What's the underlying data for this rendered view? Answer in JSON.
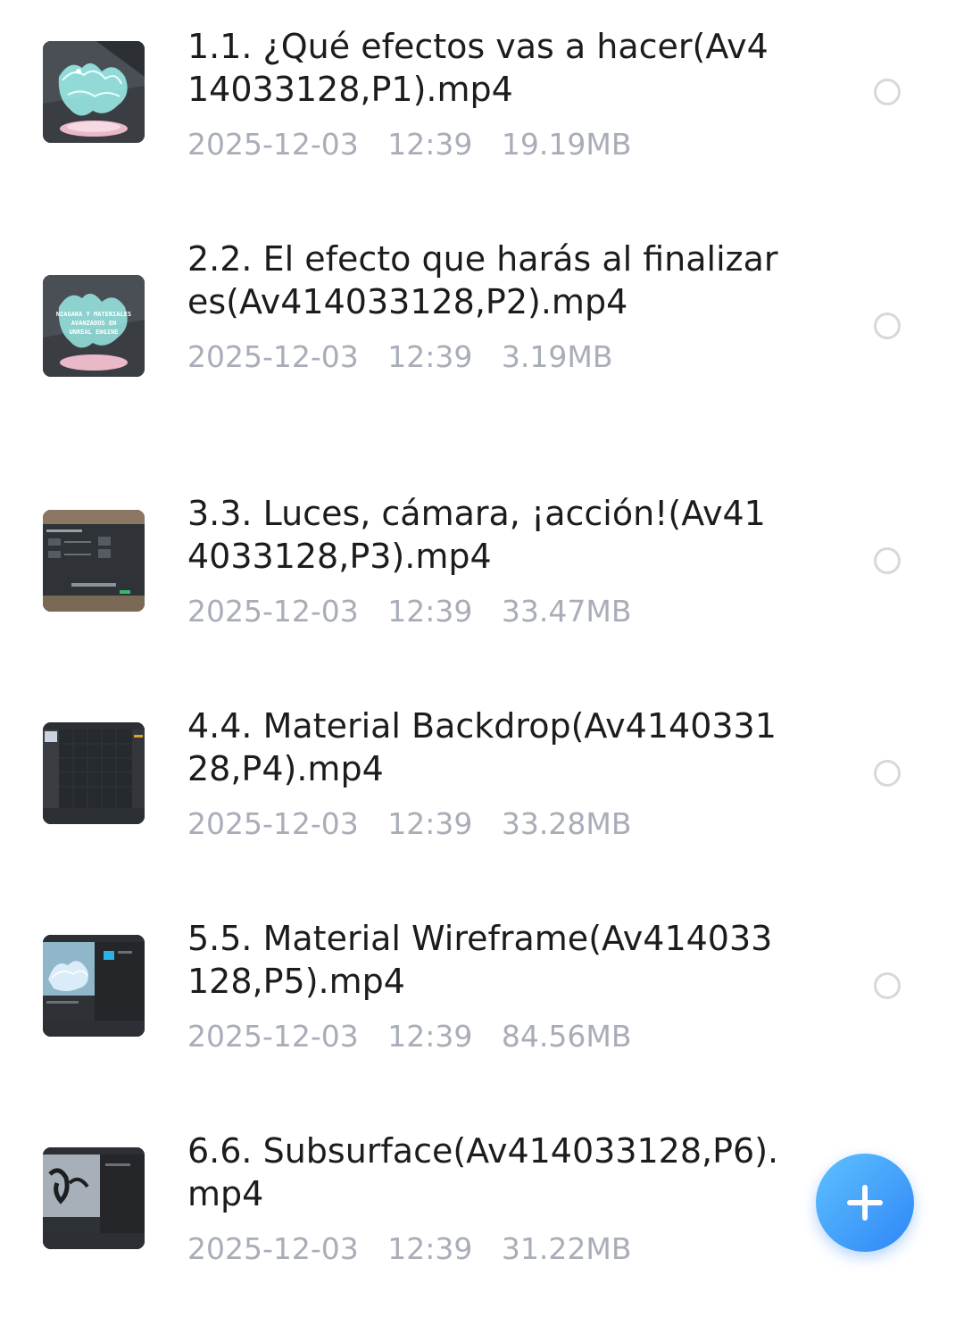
{
  "files": [
    {
      "name": "1.1. ¿Qué efectos vas a hacer(Av414033128,P1).mp4",
      "date": "2025-12-03",
      "time": "12:39",
      "size": "19.19MB",
      "thumb": "dragon-hologram"
    },
    {
      "name": "2.2. El efecto que harás al finalizar es(Av414033128,P2).mp4",
      "date": "2025-12-03",
      "time": "12:39",
      "size": "3.19MB",
      "thumb": "dragon-title-card",
      "thumb_lines": [
        "NIAGARA Y MATERIALES",
        "AVANZADOS EN",
        "UNREAL ENGINE"
      ]
    },
    {
      "name": "3.3. Luces, cámara, ¡acción!(Av414033128,P3).mp4",
      "date": "2025-12-03",
      "time": "12:39",
      "size": "33.47MB",
      "thumb": "project-settings-dialog"
    },
    {
      "name": "4.4. Material Backdrop(Av414033128,P4).mp4",
      "date": "2025-12-03",
      "time": "12:39",
      "size": "33.28MB",
      "thumb": "material-editor"
    },
    {
      "name": "5.5. Material Wireframe(Av414033128,P5).mp4",
      "date": "2025-12-03",
      "time": "12:39",
      "size": "84.56MB",
      "thumb": "wireframe-editor"
    },
    {
      "name": "6.6. Subsurface(Av414033128,P6).mp4",
      "date": "2025-12-03",
      "time": "12:39",
      "size": "31.22MB",
      "thumb": "subsurface-editor"
    }
  ],
  "fab": {
    "icon": "plus-icon"
  },
  "colors": {
    "title": "#1c1c1e",
    "meta": "#a9adb8",
    "radio_border": "#d6d8dc",
    "fab_start": "#5ec1ff",
    "fab_end": "#2f86f6"
  }
}
